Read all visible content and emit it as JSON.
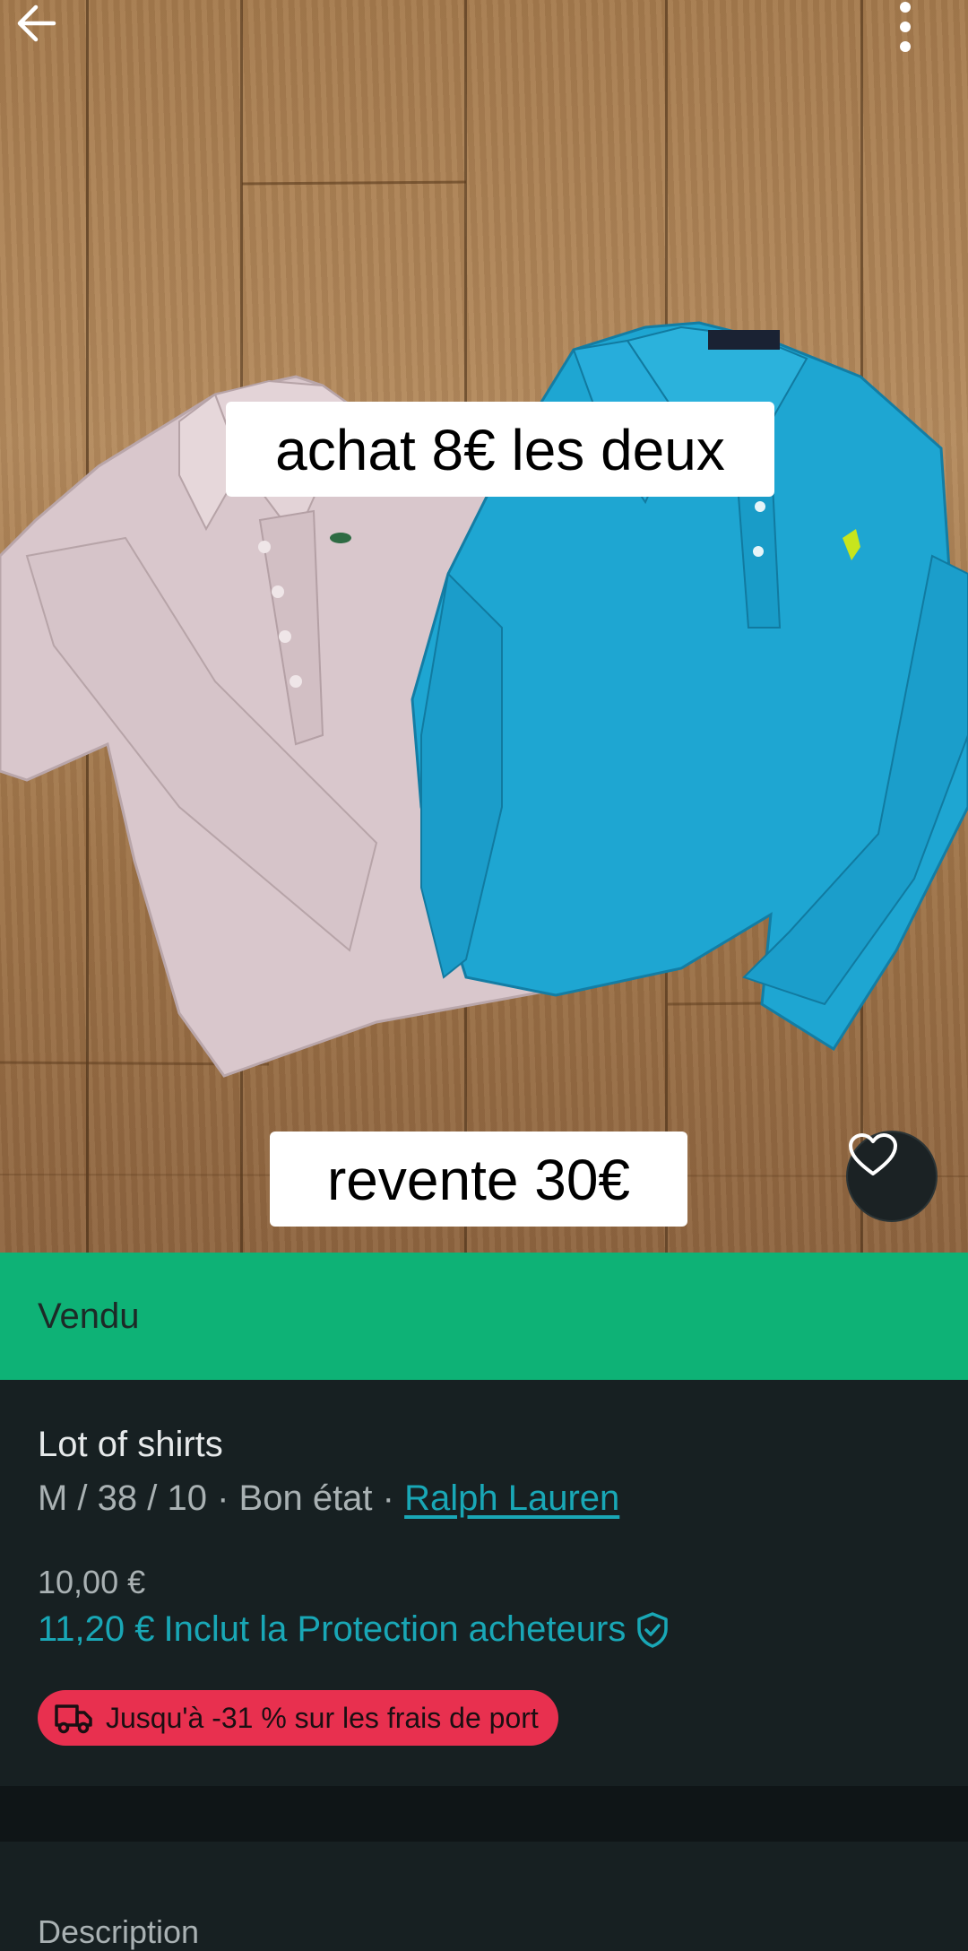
{
  "photo": {
    "caption_top": "achat 8€ les deux",
    "caption_bottom": "revente 30€",
    "icons": {
      "back": "arrow-left-icon",
      "menu": "more-vertical-icon",
      "favorite": "heart-icon"
    }
  },
  "status": {
    "label": "Vendu"
  },
  "item": {
    "title": "Lot of shirts",
    "details": "M / 38 / 10 · Bon état · ",
    "brand": "Ralph Lauren",
    "price": "10,00 €",
    "total_price": "11,20 €",
    "protection_label": "Inclut la Protection acheteurs",
    "shipping_promo": "Jusqu'à -31 % sur les frais de port"
  },
  "description": {
    "heading": "Description"
  },
  "colors": {
    "accent": "#19a7b6",
    "sold_banner": "#0eb276",
    "promo_badge": "#e8304f",
    "background": "#172022"
  }
}
